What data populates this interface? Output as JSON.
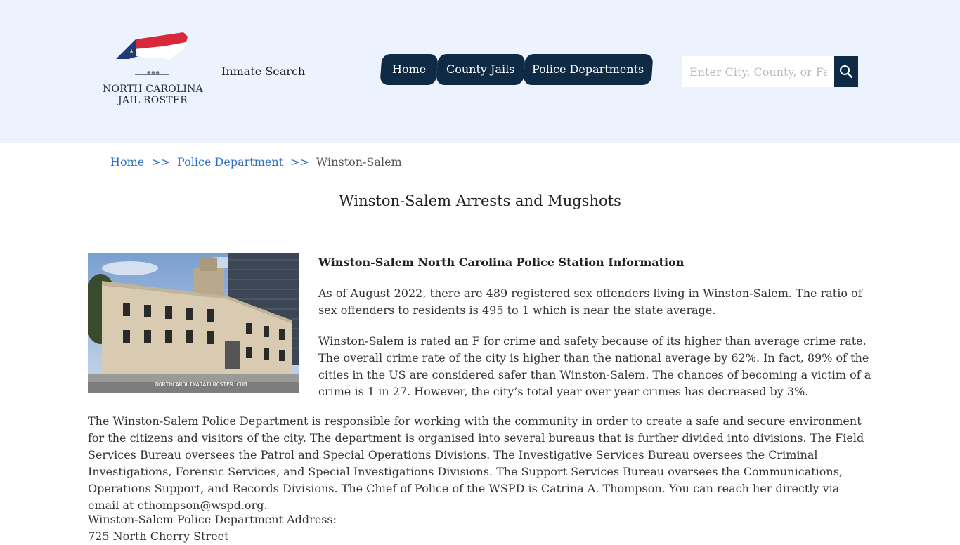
{
  "header": {
    "logo_line1": "NORTH CAROLINA",
    "logo_line2": "JAIL ROSTER",
    "inmate_search": "Inmate Search",
    "nav": [
      {
        "label": "Home"
      },
      {
        "label": "County Jails"
      },
      {
        "label": "Police Departments"
      }
    ],
    "search_placeholder": "Enter City, County, or Facility"
  },
  "breadcrumb": {
    "home": "Home",
    "sep": ">>",
    "section": "Police Department",
    "current": "Winston-Salem"
  },
  "page": {
    "title": "Winston-Salem Arrests and Mugshots",
    "photo_watermark": "NORTHCAROLINAJAILROSTER.COM",
    "info_heading": "Winston-Salem North Carolina Police Station Information",
    "para1": "As of August 2022, there are 489 registered sex offenders living in Winston-Salem. The ratio of sex offenders to residents is 495 to 1 which is near the state average.",
    "para2": "Winston-Salem is rated an F for crime and safety because of its higher than average crime rate. The overall crime rate of the city is higher than the national average by 62%. In fact, 89% of the cities in the US are considered safer than Winston-Salem. The chances of becoming a victim of a crime is 1 in 27. However, the city’s total year over year crimes has decreased by 3%.",
    "para3": "The Winston-Salem Police Department is responsible for working with the community in order to create a safe and secure environment for the citizens and visitors of the city. The department is organised into several bureaus that is further divided into divisions. The Field Services Bureau oversees the Patrol and Special Operations Divisions. The Investigative Services Bureau oversees the Criminal Investigations, Forensic Services, and Special Investigations Divisions. The Support Services Bureau oversees the Communications, Operations Support, and Records Divisions. The Chief of Police of the WSPD is Catrina A. Thompson. You can reach her directly via email at cthompson@wspd.org.",
    "address_label": "Winston-Salem Police Department Address:",
    "address_street": "725 North Cherry Street"
  },
  "colors": {
    "header_bg": "#edf3fd",
    "nav_bg": "#0e2a45",
    "link": "#2f6fc5",
    "flag_red": "#d8283a",
    "flag_blue": "#1d3a7a"
  }
}
